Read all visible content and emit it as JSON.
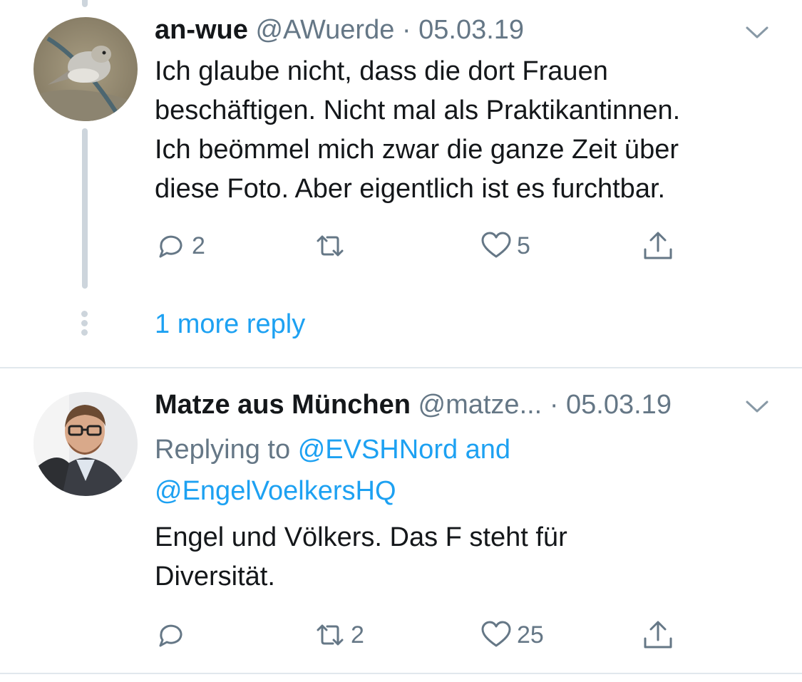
{
  "tweets": [
    {
      "display_name": "an-wue",
      "handle": "@AWuerde",
      "separator": "·",
      "date": "05.03.19",
      "text_lines": [
        "Ich glaube nicht, dass die dort Frauen",
        "beschäftigen. Nicht mal als Praktikantinnen.",
        "Ich beömmel mich zwar die ganze Zeit über",
        "diese Foto. Aber eigentlich ist es furchtbar."
      ],
      "actions": {
        "reply_count": "2",
        "retweet_count": "",
        "like_count": "5"
      },
      "avatar_icon": "sparrow-photo-avatar"
    },
    {
      "display_name": "Matze aus München",
      "handle": "@matze...",
      "separator": "·",
      "date": "05.03.19",
      "reply_prefix": "Replying to",
      "reply_mention_1": "@EVSHNord and",
      "reply_mention_2": "@EngelVoelkersHQ",
      "text_lines": [
        "Engel und Völkers. Das F steht für",
        "Diversität."
      ],
      "actions": {
        "reply_count": "",
        "retweet_count": "2",
        "like_count": "25"
      },
      "avatar_icon": "person-photo-avatar"
    }
  ],
  "more_replies_label": "1 more reply",
  "colors": {
    "link": "#1da1f2",
    "muted": "#657786",
    "text": "#14171a",
    "thread": "#cdd5dc",
    "divider": "#e1e8ed"
  },
  "icons": [
    "reply-icon",
    "retweet-icon",
    "like-icon",
    "share-icon",
    "chevron-down-icon"
  ]
}
